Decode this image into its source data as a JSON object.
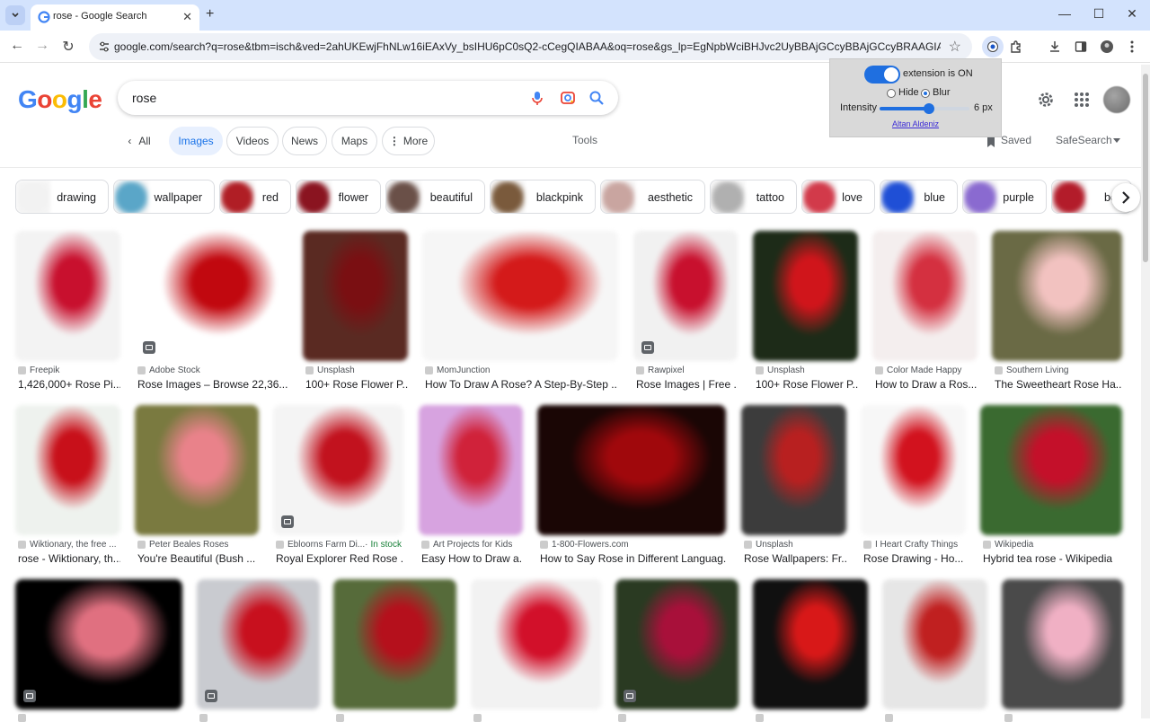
{
  "browser": {
    "tab_title": "rose - Google Search",
    "url": "google.com/search?q=rose&tbm=isch&ved=2ahUKEwjFhNLw16iEAxVy_bsIHU6pC0sQ2-cCegQIABAA&oq=rose&gs_lp=EgNpbWciBHJvc2UyBBAjGCcyBBAjGCcyBRAAGIAEMgUQABiAB..."
  },
  "google": {
    "logo": "Google",
    "logo_colors": [
      "#4285F4",
      "#EA4335",
      "#FBBC05",
      "#4285F4",
      "#34A853",
      "#EA4335"
    ],
    "query": "rose",
    "filters": [
      "All",
      "Images",
      "Videos",
      "News",
      "Maps",
      "More"
    ],
    "tools": "Tools",
    "saved": "Saved",
    "safesearch": "SafeSearch"
  },
  "extension": {
    "status": "extension is ON",
    "enabled": true,
    "mode_hide": "Hide",
    "mode_blur": "Blur",
    "selected_mode": "Blur",
    "intensity_label": "Intensity",
    "intensity_value": "6 px",
    "intensity_fraction": 0.55,
    "author": "Altan Aldeniz"
  },
  "related": [
    {
      "label": "drawing",
      "color": "#f2f2f2"
    },
    {
      "label": "wallpaper",
      "color": "#5aa6c8"
    },
    {
      "label": "red",
      "color": "#b01e25"
    },
    {
      "label": "flower",
      "color": "#8a1420"
    },
    {
      "label": "beautiful",
      "color": "#6a5048"
    },
    {
      "label": "blackpink",
      "color": "#7a5a3c"
    },
    {
      "label": "aesthetic",
      "color": "#c9a5a0"
    },
    {
      "label": "tattoo",
      "color": "#b0b0b0"
    },
    {
      "label": "love",
      "color": "#d23a4a"
    },
    {
      "label": "blue",
      "color": "#1f4fd6"
    },
    {
      "label": "purple",
      "color": "#8a6ad0"
    },
    {
      "label": "bou",
      "color": "#b31c2a"
    }
  ],
  "results": [
    {
      "source": "Freepik",
      "caption": "1,426,000+ Rose Pi...",
      "bg": "#f3f3f3",
      "fg": "#c8102e",
      "badge": false,
      "stock": ""
    },
    {
      "source": "Adobe Stock",
      "caption": "Rose Images – Browse 22,36...",
      "bg": "#ffffff",
      "fg": "#c1080f",
      "badge": true,
      "stock": ""
    },
    {
      "source": "Unsplash",
      "caption": "100+ Rose Flower P...",
      "bg": "#5a2a22",
      "fg": "#7a0f12",
      "badge": false,
      "stock": ""
    },
    {
      "source": "MomJunction",
      "caption": "How To Draw A Rose? A Step-By-Step ...",
      "bg": "#f6f6f6",
      "fg": "#d41a1a",
      "badge": false,
      "stock": ""
    },
    {
      "source": "Rawpixel",
      "caption": "Rose Images | Free ...",
      "bg": "#f1f1f1",
      "fg": "#c8102e",
      "badge": true,
      "stock": ""
    },
    {
      "source": "Unsplash",
      "caption": "100+ Rose Flower P...",
      "bg": "#1d2b18",
      "fg": "#d0151b",
      "badge": false,
      "stock": ""
    },
    {
      "source": "Color Made Happy",
      "caption": "How to Draw a Ros...",
      "bg": "#f4eeee",
      "fg": "#d43040",
      "badge": false,
      "stock": ""
    },
    {
      "source": "Southern Living",
      "caption": "The Sweetheart Rose Ha...",
      "bg": "#6a6a45",
      "fg": "#f2c2c0",
      "badge": false,
      "stock": ""
    },
    {
      "source": "Wiktionary, the free ...",
      "caption": "rose - Wiktionary, th...",
      "bg": "#eef2ee",
      "fg": "#c8101a",
      "badge": false,
      "stock": ""
    },
    {
      "source": "Peter Beales Roses",
      "caption": "You're Beautiful (Bush ...",
      "bg": "#7a7a40",
      "fg": "#e9828a",
      "badge": false,
      "stock": ""
    },
    {
      "source": "Ebloorns Farm Di...",
      "caption": "Royal Explorer Red Rose ...",
      "bg": "#f4f4f4",
      "fg": "#c2121e",
      "badge": true,
      "stock": "In stock"
    },
    {
      "source": "Art Projects for Kids",
      "caption": "Easy How to Draw a...",
      "bg": "#d7a3e0",
      "fg": "#d0223a",
      "badge": false,
      "stock": ""
    },
    {
      "source": "1-800-Flowers.com",
      "caption": "How to Say Rose in Different Languag...",
      "bg": "#1a0605",
      "fg": "#a0080c",
      "badge": false,
      "stock": ""
    },
    {
      "source": "Unsplash",
      "caption": "Rose Wallpapers: Fr...",
      "bg": "#3c3c3c",
      "fg": "#b82020",
      "badge": false,
      "stock": ""
    },
    {
      "source": "I Heart Crafty Things",
      "caption": "Rose Drawing - Ho...",
      "bg": "#f7f7f7",
      "fg": "#d2121e",
      "badge": false,
      "stock": ""
    },
    {
      "source": "Wikipedia",
      "caption": "Hybrid tea rose - Wikipedia",
      "bg": "#3a6a30",
      "fg": "#c4102a",
      "badge": false,
      "stock": ""
    },
    {
      "source": "",
      "caption": "",
      "bg": "#000000",
      "fg": "#e07080",
      "badge": true,
      "stock": ""
    },
    {
      "source": "",
      "caption": "",
      "bg": "#c9cbd0",
      "fg": "#c8101e",
      "badge": true,
      "stock": ""
    },
    {
      "source": "",
      "caption": "",
      "bg": "#566b3a",
      "fg": "#b5101c",
      "badge": false,
      "stock": ""
    },
    {
      "source": "",
      "caption": "",
      "bg": "#f2f2f2",
      "fg": "#d2102a",
      "badge": false,
      "stock": ""
    },
    {
      "source": "",
      "caption": "",
      "bg": "#2a3a22",
      "fg": "#a8103a",
      "badge": true,
      "stock": ""
    },
    {
      "source": "",
      "caption": "",
      "bg": "#101010",
      "fg": "#d81818",
      "badge": false,
      "stock": ""
    },
    {
      "source": "",
      "caption": "",
      "bg": "#e6e6e6",
      "fg": "#c02020",
      "badge": false,
      "stock": ""
    },
    {
      "source": "",
      "caption": "",
      "bg": "#4a4a4a",
      "fg": "#f0b0c4",
      "badge": false,
      "stock": ""
    }
  ]
}
